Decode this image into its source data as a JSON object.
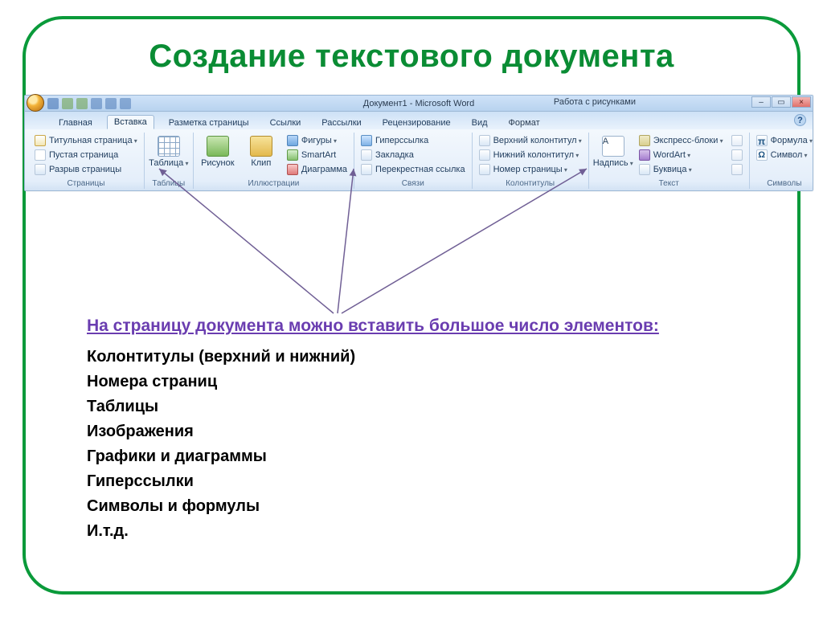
{
  "slide": {
    "title": "Создание текстового документа",
    "window_title": "Документ1 - Microsoft Word",
    "tool_tab_title": "Работа с рисунками"
  },
  "tabs": {
    "home": "Главная",
    "insert": "Вставка",
    "layout": "Разметка страницы",
    "refs": "Ссылки",
    "mail": "Рассылки",
    "review": "Рецензирование",
    "view": "Вид",
    "format": "Формат"
  },
  "groups": {
    "pages": {
      "label": "Страницы",
      "cover": "Титульная страница",
      "blank": "Пустая страница",
      "break": "Разрыв страницы"
    },
    "tables": {
      "label": "Таблицы",
      "table": "Таблица"
    },
    "illus": {
      "label": "Иллюстрации",
      "picture": "Рисунок",
      "clip": "Клип",
      "shapes": "Фигуры",
      "smartart": "SmartArt",
      "chart": "Диаграмма"
    },
    "links": {
      "label": "Связи",
      "hyperlink": "Гиперссылка",
      "bookmark": "Закладка",
      "xref": "Перекрестная ссылка"
    },
    "headers": {
      "label": "Колонтитулы",
      "header": "Верхний колонтитул",
      "footer": "Нижний колонтитул",
      "pagenr": "Номер страницы"
    },
    "text": {
      "label": "Текст",
      "textbox": "Надпись",
      "blocks": "Экспресс-блоки",
      "wordart": "WordArt",
      "dropcap": "Буквица",
      "sig": "",
      "dt": "",
      "obj": ""
    },
    "symbols": {
      "label": "Символы",
      "equation": "Формула",
      "symbol": "Символ"
    }
  },
  "body": {
    "heading": "На страницу документа можно вставить большое число элементов:",
    "items": [
      "Колонтитулы (верхний и нижний)",
      "Номера страниц",
      "Таблицы",
      "Изображения",
      "Графики и диаграммы",
      "Гиперссылки",
      "Символы и формулы",
      "И.т.д."
    ]
  }
}
